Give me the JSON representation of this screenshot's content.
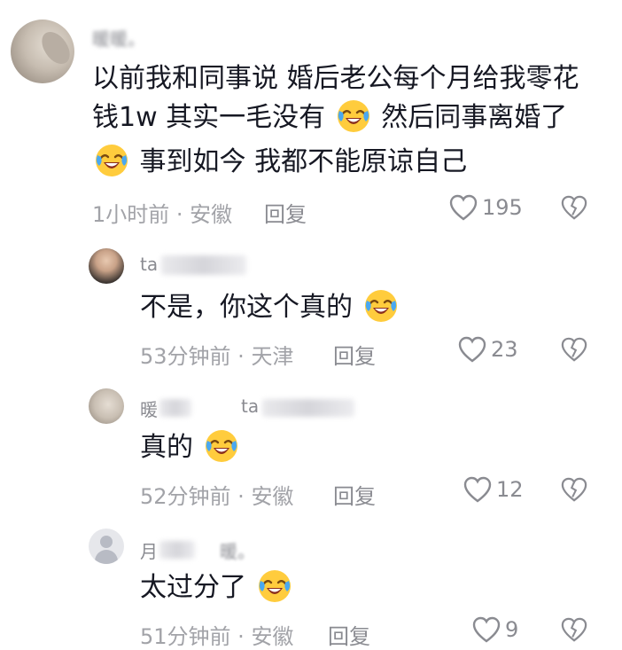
{
  "comments": [
    {
      "username": "暖暖。",
      "lines": [
        "以前我和同事说  婚后老公每个月给我零花",
        "钱1w  其实一毛没有",
        "  然后同事离婚了",
        "事到如今 我都不能原谅自己"
      ],
      "time": "1小时前",
      "location": "安徽",
      "reply_label": "回复",
      "likes": "195"
    },
    {
      "username": "ta",
      "text": "不是，你这个真的",
      "time": "53分钟前",
      "location": "天津",
      "reply_label": "回复",
      "likes": "23"
    },
    {
      "username": "暖",
      "reply_to": "ta",
      "text": "真的",
      "time": "52分钟前",
      "location": "安徽",
      "reply_label": "回复",
      "likes": "12"
    },
    {
      "username": "月",
      "reply_to": "暖。",
      "text": "太过分了",
      "time": "51分钟前",
      "location": "安徽",
      "reply_label": "回复",
      "likes": "9"
    }
  ],
  "meta_separator": " · ",
  "icons": {
    "like": "heart-outline-icon",
    "dislike": "broken-heart-icon",
    "emoji": "crying-laughing-emoji-icon"
  },
  "colors": {
    "text": "#161823",
    "meta": "#a2a3a8",
    "icon": "#8a8b91"
  }
}
